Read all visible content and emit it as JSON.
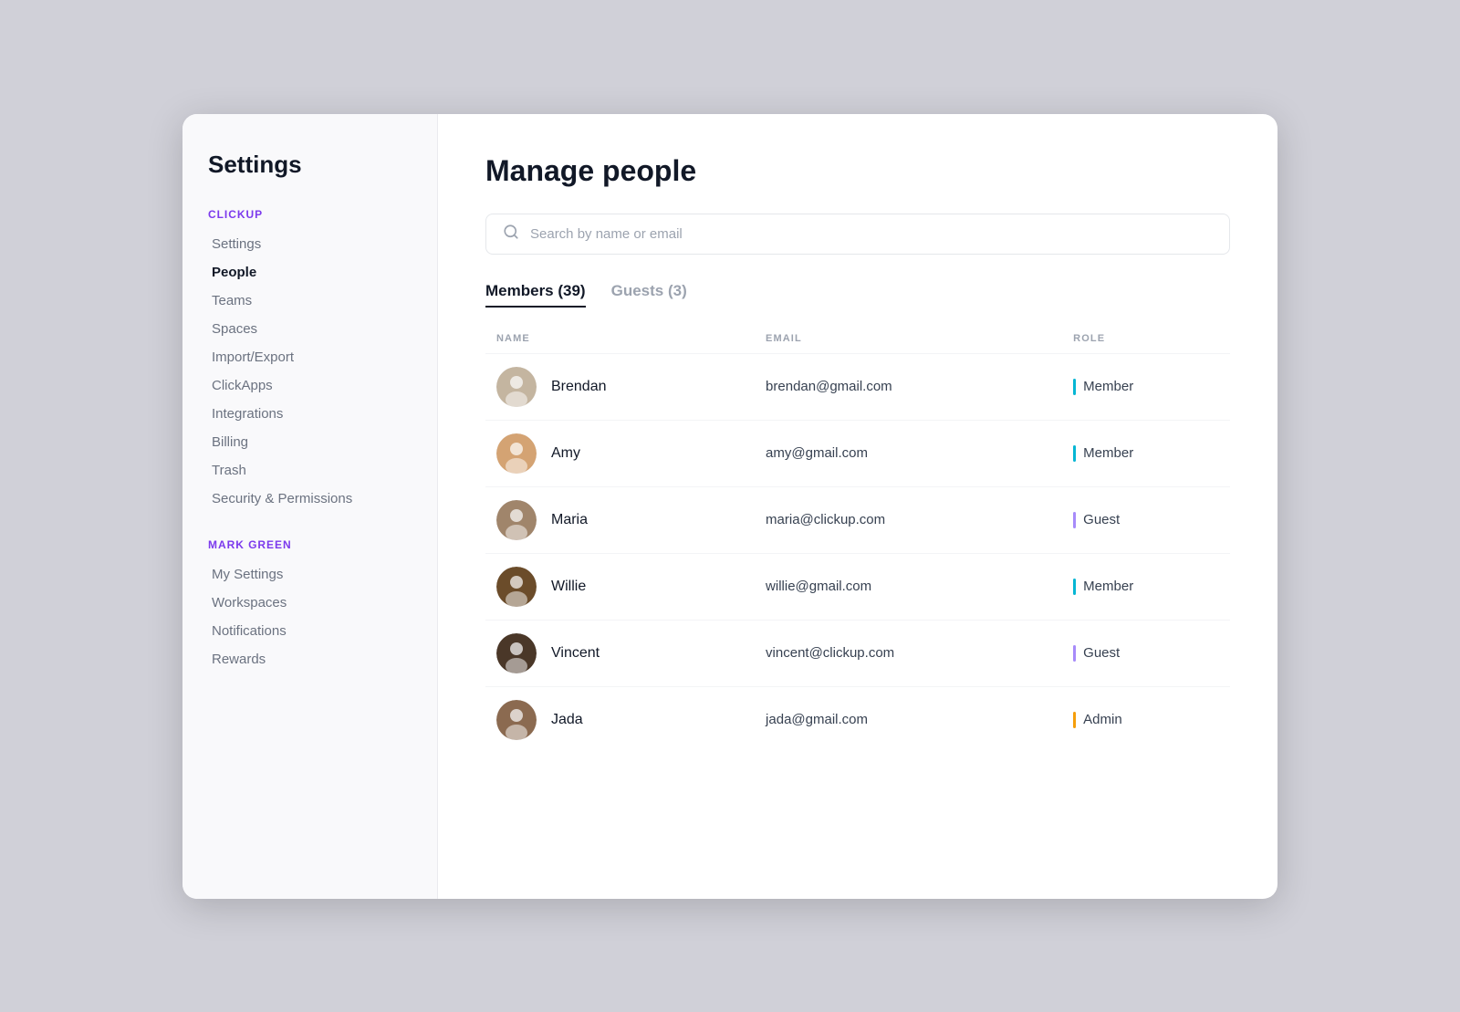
{
  "sidebar": {
    "title": "Settings",
    "clickup_label": "CLICKUP",
    "mark_label": "MARK GREEN",
    "clickup_items": [
      {
        "id": "settings",
        "label": "Settings",
        "active": false
      },
      {
        "id": "people",
        "label": "People",
        "active": true
      },
      {
        "id": "teams",
        "label": "Teams",
        "active": false
      },
      {
        "id": "spaces",
        "label": "Spaces",
        "active": false
      },
      {
        "id": "import-export",
        "label": "Import/Export",
        "active": false
      },
      {
        "id": "clickapps",
        "label": "ClickApps",
        "active": false
      },
      {
        "id": "integrations",
        "label": "Integrations",
        "active": false
      },
      {
        "id": "billing",
        "label": "Billing",
        "active": false
      },
      {
        "id": "trash",
        "label": "Trash",
        "active": false
      },
      {
        "id": "security",
        "label": "Security & Permissions",
        "active": false
      }
    ],
    "mark_items": [
      {
        "id": "my-settings",
        "label": "My Settings"
      },
      {
        "id": "workspaces",
        "label": "Workspaces"
      },
      {
        "id": "notifications",
        "label": "Notifications"
      },
      {
        "id": "rewards",
        "label": "Rewards"
      }
    ]
  },
  "main": {
    "page_title": "Manage people",
    "search_placeholder": "Search by name or email",
    "tabs": [
      {
        "id": "members",
        "label": "Members (39)",
        "active": true
      },
      {
        "id": "guests",
        "label": "Guests (3)",
        "active": false
      }
    ],
    "table": {
      "columns": [
        "NAME",
        "EMAIL",
        "ROLE"
      ],
      "rows": [
        {
          "id": 1,
          "name": "Brendan",
          "email": "brendan@gmail.com",
          "role": "Member",
          "role_type": "member"
        },
        {
          "id": 2,
          "name": "Amy",
          "email": "amy@gmail.com",
          "role": "Member",
          "role_type": "member"
        },
        {
          "id": 3,
          "name": "Maria",
          "email": "maria@clickup.com",
          "role": "Guest",
          "role_type": "guest"
        },
        {
          "id": 4,
          "name": "Willie",
          "email": "willie@gmail.com",
          "role": "Member",
          "role_type": "member"
        },
        {
          "id": 5,
          "name": "Vincent",
          "email": "vincent@clickup.com",
          "role": "Guest",
          "role_type": "guest"
        },
        {
          "id": 6,
          "name": "Jada",
          "email": "jada@gmail.com",
          "role": "Admin",
          "role_type": "admin"
        }
      ]
    }
  }
}
